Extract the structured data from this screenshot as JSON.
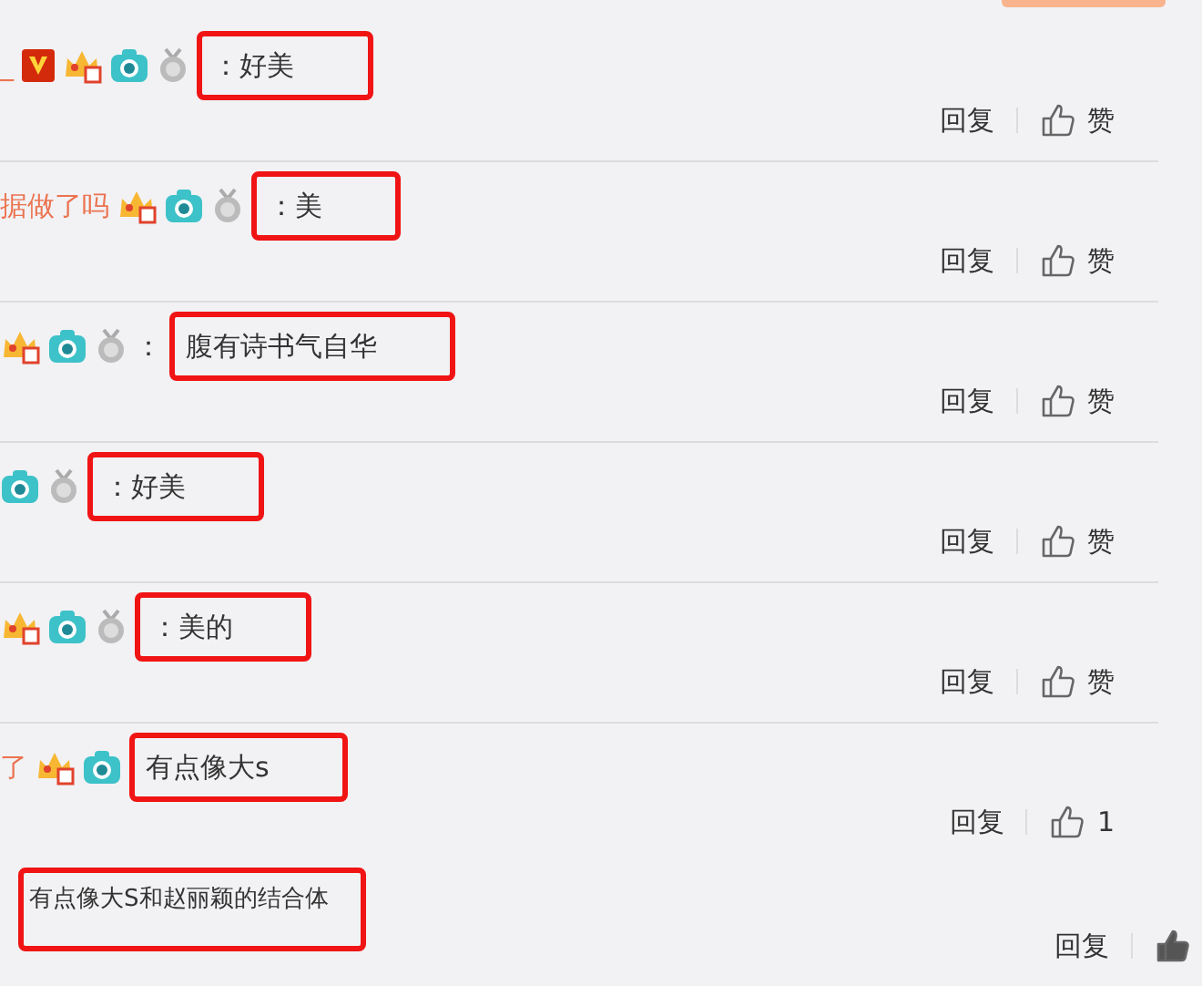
{
  "comments": [
    {
      "username": "_",
      "badges": [
        {
          "kind": "vip"
        },
        {
          "kind": "crown"
        },
        {
          "kind": "camera"
        },
        {
          "kind": "medal"
        }
      ],
      "text": "：好美",
      "reply": "回复",
      "like": "赞"
    },
    {
      "username": "据做了吗",
      "badges": [
        {
          "kind": "crown"
        },
        {
          "kind": "camera"
        },
        {
          "kind": "medal"
        }
      ],
      "text": "：美",
      "reply": "回复",
      "like": "赞"
    },
    {
      "badges": [
        {
          "kind": "crown"
        },
        {
          "kind": "camera"
        },
        {
          "kind": "medal"
        }
      ],
      "pre": "：",
      "text": "腹有诗书气自华",
      "reply": "回复",
      "like": "赞"
    },
    {
      "badges": [
        {
          "kind": "camera"
        },
        {
          "kind": "medal"
        }
      ],
      "text": "：好美",
      "reply": "回复",
      "like": "赞"
    },
    {
      "badges": [
        {
          "kind": "crown"
        },
        {
          "kind": "camera"
        },
        {
          "kind": "medal"
        }
      ],
      "text": "：美的",
      "reply": "回复",
      "like": "赞"
    },
    {
      "username": "了",
      "badges": [
        {
          "kind": "crown"
        },
        {
          "kind": "camera"
        }
      ],
      "text": "有点像大s",
      "reply": "回复",
      "like": "1"
    }
  ],
  "sub_reply": {
    "text": "有点像大S和赵丽颖的结合体",
    "reply": "回复"
  }
}
